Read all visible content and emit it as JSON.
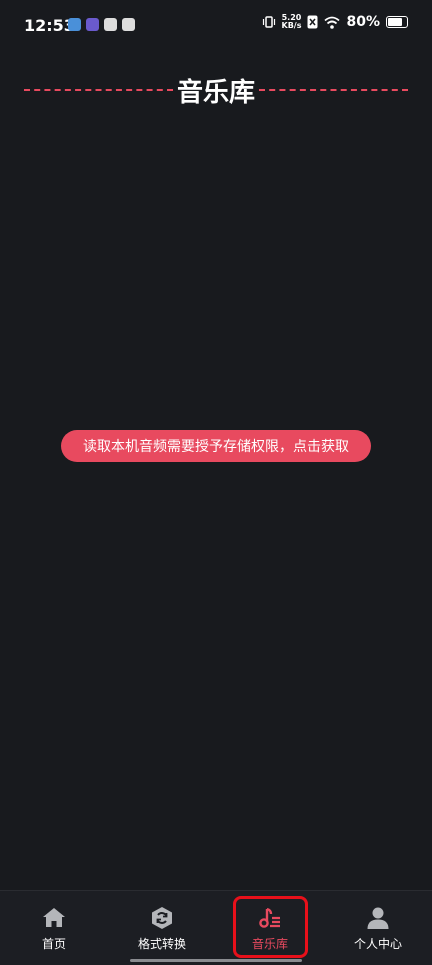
{
  "status_bar": {
    "time": "12:53",
    "net_speed_top": "5.20",
    "net_speed_bottom": "KB/s",
    "battery": "80%"
  },
  "header": {
    "title": "音乐库"
  },
  "main": {
    "permission_prompt": "读取本机音频需要授予存储权限，点击获取"
  },
  "tabbar": {
    "tabs": [
      {
        "label": "首页",
        "icon": "home-icon"
      },
      {
        "label": "格式转换",
        "icon": "convert-icon"
      },
      {
        "label": "音乐库",
        "icon": "music-icon"
      },
      {
        "label": "个人中心",
        "icon": "person-icon"
      }
    ],
    "active_index": 2
  },
  "colors": {
    "background": "#181a1e",
    "accent": "#e84a5f",
    "highlight": "#e8101a"
  }
}
